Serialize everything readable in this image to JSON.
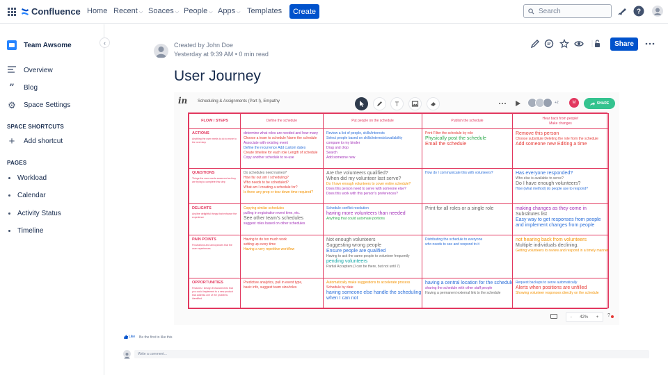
{
  "topnav": {
    "logo": "Confluence",
    "items": [
      {
        "label": "Home",
        "dropdown": false
      },
      {
        "label": "Recent",
        "dropdown": true
      },
      {
        "label": "Soaces",
        "dropdown": true
      },
      {
        "label": "People",
        "dropdown": true
      },
      {
        "label": "Apps",
        "dropdown": true
      },
      {
        "label": "Templates",
        "dropdown": false
      }
    ],
    "create_label": "Create",
    "search_placeholder": "Search",
    "icons": [
      "notifications-icon",
      "help-icon",
      "profile-avatar"
    ],
    "accent": "#0052cc"
  },
  "sidebar": {
    "space_name": "Team Awsome",
    "links": [
      {
        "label": "Overview",
        "icon": "overview-icon"
      },
      {
        "label": "Blog",
        "icon": "quote-icon"
      },
      {
        "label": "Space Settings",
        "icon": "gear-icon"
      }
    ],
    "shortcuts_heading": "SPACE SHORTCUTS",
    "add_shortcut": "Add shortcut",
    "pages_heading": "PAGES",
    "pages": [
      "Workload",
      "Calendar",
      "Activity Status",
      "Timeline"
    ]
  },
  "page": {
    "author_line": "Created by John Doe",
    "time_line": "Yesterday at 9:39 AM  •  0 min read",
    "title": "User Journey",
    "share_label": "Share"
  },
  "embed": {
    "logo": "in",
    "title": "Scheduling & Assignments (Part I), Empathy",
    "share_label": "SHARE",
    "extra_count": "+2",
    "zoom_minus": "-",
    "zoom": "42%",
    "zoom_plus": "+",
    "help": "?",
    "board": {
      "header": [
        "FLOW / STEPS",
        "Define the schedule",
        "Put people on the schedule",
        "Publish the schedule",
        "Hear back from people!\nMake changes"
      ],
      "rows": [
        {
          "label": "ACTIONS",
          "sub": "Anything the user needs to do to move to the next step",
          "cells": [
            [
              {
                "t": "determine what roles are needed and how many",
                "c": "c-purple"
              },
              {
                "t": "Choose a team to schedule   Name the schedule",
                "c": "c-red"
              },
              {
                "t": "Associate with existing event",
                "c": "c-purple"
              },
              {
                "t": "Define the recurrence   Add custom dates",
                "c": "c-blue"
              },
              {
                "t": "Create timeline for each role   Length of schedule",
                "c": "c-red"
              },
              {
                "t": "Copy another schedule to re-use",
                "c": "c-purple"
              }
            ],
            [
              {
                "t": "Review a list of people, skills/interests",
                "c": "c-blue"
              },
              {
                "t": "Select people based on skills/interests/availability",
                "c": "c-blue"
              },
              {
                "t": "compare to my binder",
                "c": "c-purple"
              },
              {
                "t": "Drag and drop",
                "c": "c-purple"
              },
              {
                "t": "Search",
                "c": "c-purple"
              },
              {
                "t": "Add someone new",
                "c": "c-purple"
              }
            ],
            [
              {
                "t": "Print   Filter the schedule by role",
                "c": "c-red"
              },
              {
                "t": "Physically post the schedule",
                "c": "c-green",
                "big": true
              },
              {
                "t": "Email the schedule",
                "c": "c-red",
                "big": true
              }
            ],
            [
              {
                "t": "Remove this person",
                "c": "c-red",
                "big": true
              },
              {
                "t": "Choose substitute   Deleting the role from the schedule",
                "c": "c-red"
              },
              {
                "t": "Add someone new   Editing a time",
                "c": "c-red",
                "big": true
              }
            ]
          ]
        },
        {
          "label": "QUESTIONS",
          "sub": "Things the user needs answered as they are trying to complete this step",
          "cells": [
            [
              {
                "t": "Do schedules need names?",
                "c": "c-gray"
              },
              {
                "t": "How far out am I scheduling?",
                "c": "c-red"
              },
              {
                "t": "Who needs to be scheduled?",
                "c": "c-red"
              },
              {
                "t": "What am I creating a schedule for?",
                "c": "c-red"
              },
              {
                "t": "Is there any prep or tear down time required?",
                "c": "c-orange"
              }
            ],
            [
              {
                "t": "Are the volunteers qualified?",
                "c": "c-gray",
                "big": true
              },
              {
                "t": "When did my volunteer last serve?",
                "c": "c-gray",
                "big": true
              },
              {
                "t": "Do I have enough volunteers to cover entire schedule?",
                "c": "c-orange"
              },
              {
                "t": "Does this person need to serve with someone else?",
                "c": "c-purple"
              },
              {
                "t": "Does this work with this person's preferences?",
                "c": "c-purple"
              }
            ],
            [
              {
                "t": "How do I communicate this with volunteers?",
                "c": "c-blue"
              }
            ],
            [
              {
                "t": "Has everyone responded?",
                "c": "c-blue",
                "big": true
              },
              {
                "t": "Who else is available to serve?",
                "c": "c-gray"
              },
              {
                "t": "Do I have enough volunteers?",
                "c": "c-gray",
                "big": true
              },
              {
                "t": "How (what method) do people use to respond?",
                "c": "c-blue"
              }
            ]
          ]
        },
        {
          "label": "DELIGHTS",
          "sub": "Any/the delightful things that enhance the experience",
          "cells": [
            [
              {
                "t": "Copying similar schedules",
                "c": "c-orange"
              },
              {
                "t": "pulling in registration event time, etc.",
                "c": "c-purple"
              },
              {
                "t": "See other team's schedules",
                "c": "c-gray",
                "big": true
              },
              {
                "t": "suggest roles based on other schedules",
                "c": "c-purple"
              }
            ],
            [
              {
                "t": "Schedule conflict resolution",
                "c": "c-blue"
              },
              {
                "t": "having more volunteers than needed",
                "c": "c-purple",
                "big": true
              },
              {
                "t": "Anything that could automate portions",
                "c": "c-green"
              }
            ],
            [
              {
                "t": "Print for all roles or a single role",
                "c": "c-gray",
                "big": true
              }
            ],
            [
              {
                "t": "making changes as they come in",
                "c": "c-purple",
                "big": true
              },
              {
                "t": "Substitutes list",
                "c": "c-gray",
                "big": true
              },
              {
                "t": "Easy way to get responses from people",
                "c": "c-blue",
                "big": true
              },
              {
                "t": "and implement changes from people",
                "c": "c-blue",
                "big": true
              }
            ]
          ]
        },
        {
          "label": "PAIN POINTS",
          "sub": "Frustrations and annoyances that the user experiences",
          "cells": [
            [
              {
                "t": "Having to do too much work",
                "c": "c-red"
              },
              {
                "t": "setting up every time",
                "c": "c-red"
              },
              {
                "t": "Having a very repetitive workflow",
                "c": "c-orange"
              }
            ],
            [
              {
                "t": "Not enough volunteers",
                "c": "c-gray",
                "big": true
              },
              {
                "t": "Suggesting wrong people",
                "c": "c-gray",
                "big": true
              },
              {
                "t": "Ensure people are qualified",
                "c": "c-blue",
                "big": true
              },
              {
                "t": "Having to ask the same people to volunteer frequently",
                "c": "c-gray"
              },
              {
                "t": "pending volunteers",
                "c": "c-teal",
                "big": true
              },
              {
                "t": "Partial Accepters (I can be there, but not until 7)",
                "c": "c-gray"
              }
            ],
            [
              {
                "t": "Distributing the schedule to everyone",
                "c": "c-blue"
              },
              {
                "t": "who needs to see and respond to it",
                "c": "c-blue"
              }
            ],
            [
              {
                "t": "not hearing back from volunteers",
                "c": "c-orange",
                "big": true
              },
              {
                "t": "Multiple individuals declining.",
                "c": "c-gray",
                "big": true
              },
              {
                "t": "Getting volunteers to review and respond in a timely manner",
                "c": "c-orange"
              }
            ]
          ]
        },
        {
          "label": "OPPORTUNITIES",
          "sub": "Features / Design Enhancements that you could implement to a new product that address one of the problems identified",
          "cells": [
            [
              {
                "t": "Predictive analytics, pull in event type,",
                "c": "c-red"
              },
              {
                "t": "basic info, suggest team size/roles",
                "c": "c-red"
              }
            ],
            [
              {
                "t": "Automatically make suggestions to accelerate process",
                "c": "c-orange"
              },
              {
                "t": "Schedule by date",
                "c": "c-red"
              },
              {
                "t": "having someone else handle the scheduling",
                "c": "c-blue",
                "big": true
              },
              {
                "t": "when I can not",
                "c": "c-blue",
                "big": true
              }
            ],
            [
              {
                "t": "having a central location for the schedule",
                "c": "c-blue",
                "big": true
              },
              {
                "t": "sharing the schedule with other staff people",
                "c": "c-purple"
              },
              {
                "t": "Having a permanent external link to the schedule",
                "c": "c-gray"
              }
            ],
            [
              {
                "t": "Request backups to serve automatically",
                "c": "c-blue"
              },
              {
                "t": "Alerts when positions are unfilled",
                "c": "c-red",
                "big": true
              },
              {
                "t": "Showing volunteer responses directly on the schedule",
                "c": "c-orange"
              }
            ]
          ]
        }
      ]
    }
  },
  "footer": {
    "like_label": "Like",
    "like_text": "Be the first to like this",
    "comment_placeholder": "Write a comment..."
  }
}
